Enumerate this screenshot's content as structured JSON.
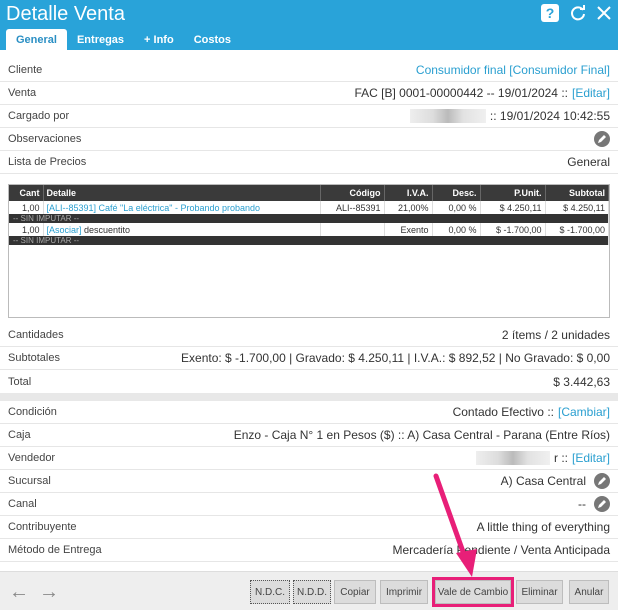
{
  "window": {
    "title": "Detalle Venta"
  },
  "tabs": [
    {
      "label": "General"
    },
    {
      "label": "Entregas"
    },
    {
      "label": "+ Info"
    },
    {
      "label": "Costos"
    }
  ],
  "info": {
    "cliente": {
      "label": "Cliente",
      "value": "Consumidor final [Consumidor Final]"
    },
    "venta": {
      "label": "Venta",
      "value": "FAC [B] 0001-00000442 -- 19/01/2024 ::",
      "link": "[Editar]"
    },
    "cargado": {
      "label": "Cargado por",
      "value": ":: 19/01/2024 10:42:55"
    },
    "observaciones": {
      "label": "Observaciones"
    },
    "lista_precios": {
      "label": "Lista de Precios",
      "value": "General"
    }
  },
  "table": {
    "headers": [
      "Cant",
      "Detalle",
      "Código",
      "I.V.A.",
      "Desc.",
      "P.Unit.",
      "Subtotal"
    ],
    "rows": [
      {
        "cant": "1,00",
        "detalle": "[ALI--85391] Café \"La eléctrica\" - Probando probando",
        "codigo": "ALI--85391",
        "iva": "21,00%",
        "desc": "0,00 %",
        "punit": "$ 4.250,11",
        "subtotal": "$ 4.250,11",
        "note": "-- SIN IMPUTAR --"
      },
      {
        "cant": "1,00",
        "detalle_link": "[Asociar]",
        "detalle": "descuentito",
        "codigo": "",
        "iva": "Exento",
        "desc": "0,00 %",
        "punit": "$ -1.700,00",
        "subtotal": "$ -1.700,00",
        "note": "-- SIN IMPUTAR --"
      }
    ]
  },
  "totals": {
    "cantidades": {
      "label": "Cantidades",
      "value": "2 ítems / 2 unidades"
    },
    "subtotales": {
      "label": "Subtotales",
      "value": "Exento: $ -1.700,00 | Gravado: $ 4.250,11 | I.V.A.: $ 892,52 | No Gravado: $ 0,00"
    },
    "total": {
      "label": "Total",
      "value": "$ 3.442,63"
    }
  },
  "details": {
    "condicion": {
      "label": "Condición",
      "value": "Contado Efectivo ::",
      "link": "[Cambiar]"
    },
    "caja": {
      "label": "Caja",
      "value": "Enzo - Caja N° 1 en Pesos ($) :: A) Casa Central - Parana (Entre Ríos)"
    },
    "vendedor": {
      "label": "Vendedor",
      "value": "r ::",
      "link": "[Editar]"
    },
    "sucursal": {
      "label": "Sucursal",
      "value": "A) Casa Central"
    },
    "canal": {
      "label": "Canal",
      "value": "--"
    },
    "contribuyente": {
      "label": "Contribuyente",
      "value": "A little thing of everything"
    },
    "metodo": {
      "label": "Método de Entrega",
      "value": "Mercadería Pendiente / Venta Anticipada"
    }
  },
  "footer": {
    "buttons": [
      "N.D.C.",
      "N.D.D.",
      "Copiar",
      "Imprimir",
      "Vale de Cambio",
      "Eliminar",
      "Anular"
    ]
  },
  "colors": {
    "header": "#29a3d9",
    "accent": "#2a9fd0",
    "highlight": "#e81f78"
  }
}
